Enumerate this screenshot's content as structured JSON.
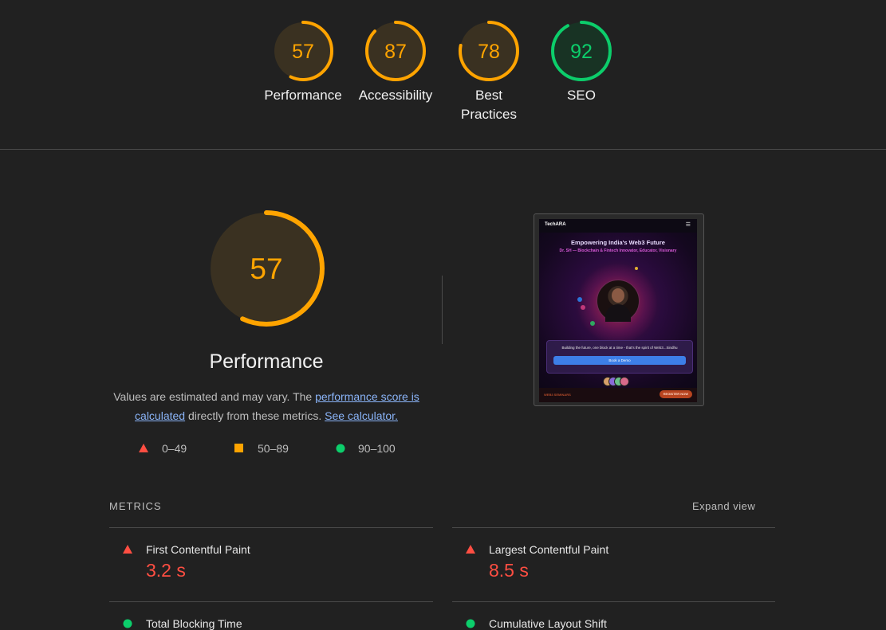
{
  "colors": {
    "fail": "#ff4e42",
    "average": "#ffa400",
    "pass": "#0cce6b",
    "link": "#8ab4f8"
  },
  "categories": [
    {
      "label": "Performance",
      "score": 57,
      "status": "average"
    },
    {
      "label": "Accessibility",
      "score": 87,
      "status": "average"
    },
    {
      "label": "Best\nPractices",
      "score": 78,
      "status": "average"
    },
    {
      "label": "SEO",
      "score": 92,
      "status": "pass"
    }
  ],
  "main": {
    "score": 57,
    "title": "Performance",
    "desc_pre": "Values are estimated and may vary. The ",
    "desc_link1": "performance score is calculated",
    "desc_mid": " directly from these metrics. ",
    "desc_link2": "See calculator."
  },
  "legend": [
    {
      "range": "0–49",
      "icon": "triangle-icon"
    },
    {
      "range": "50–89",
      "icon": "square-icon"
    },
    {
      "range": "90–100",
      "icon": "circle-icon"
    }
  ],
  "screenshot": {
    "brand": "TechARA",
    "title": "Empowering India's Web3 Future",
    "subtitle": "Dr. SH — Blockchain & Fintech Innovator, Educator, Visionary",
    "quote": "Building the future, one block at a time - that's the spirit of Web3...Sindhu",
    "button": "Book a Demo",
    "footer_left": "WEB3 SEMINARS",
    "footer_right": "REGISTER NOW"
  },
  "metrics": {
    "heading": "METRICS",
    "expand": "Expand view",
    "items": [
      {
        "name": "First Contentful Paint",
        "value": "3.2 s",
        "status": "fail"
      },
      {
        "name": "Largest Contentful Paint",
        "value": "8.5 s",
        "status": "fail"
      },
      {
        "name": "Total Blocking Time",
        "value": "",
        "status": "pass"
      },
      {
        "name": "Cumulative Layout Shift",
        "value": "",
        "status": "pass"
      }
    ]
  }
}
